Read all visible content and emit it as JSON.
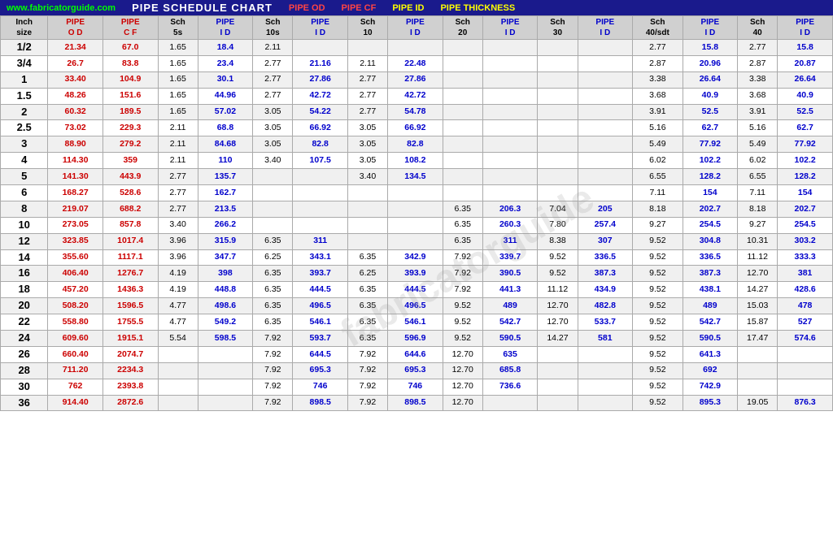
{
  "header": {
    "site": "www.fabricatorguide.com",
    "title": "PIPE SCHEDULE CHART",
    "od_label": "PIPE OD",
    "cf_label": "PIPE CF",
    "id_label": "PIPE ID",
    "thick_label": "PIPE THICKNESS"
  },
  "columns": [
    "Inch size",
    "PIPE OD",
    "PIPE CF",
    "Sch 5s",
    "PIPE ID",
    "Sch 10s",
    "PIPE ID",
    "Sch 10",
    "PIPE ID",
    "Sch 20",
    "PIPE ID",
    "Sch 30",
    "PIPE ID",
    "Sch 40/sdt",
    "PIPE ID",
    "Sch 40",
    "PIPE ID"
  ],
  "rows": [
    [
      "1/2",
      "21.34",
      "67.0",
      "1.65",
      "18.4",
      "2.11",
      "",
      "",
      "",
      "",
      "",
      "",
      "",
      "2.77",
      "15.8",
      "2.77",
      "15.8"
    ],
    [
      "3/4",
      "26.7",
      "83.8",
      "1.65",
      "23.4",
      "2.77",
      "21.16",
      "2.11",
      "22.48",
      "",
      "",
      "",
      "",
      "2.87",
      "20.96",
      "2.87",
      "20.87"
    ],
    [
      "1",
      "33.40",
      "104.9",
      "1.65",
      "30.1",
      "2.77",
      "27.86",
      "2.77",
      "27.86",
      "",
      "",
      "",
      "",
      "3.38",
      "26.64",
      "3.38",
      "26.64"
    ],
    [
      "1.5",
      "48.26",
      "151.6",
      "1.65",
      "44.96",
      "2.77",
      "42.72",
      "2.77",
      "42.72",
      "",
      "",
      "",
      "",
      "3.68",
      "40.9",
      "3.68",
      "40.9"
    ],
    [
      "2",
      "60.32",
      "189.5",
      "1.65",
      "57.02",
      "3.05",
      "54.22",
      "2.77",
      "54.78",
      "",
      "",
      "",
      "",
      "3.91",
      "52.5",
      "3.91",
      "52.5"
    ],
    [
      "2.5",
      "73.02",
      "229.3",
      "2.11",
      "68.8",
      "3.05",
      "66.92",
      "3.05",
      "66.92",
      "",
      "",
      "",
      "",
      "5.16",
      "62.7",
      "5.16",
      "62.7"
    ],
    [
      "3",
      "88.90",
      "279.2",
      "2.11",
      "84.68",
      "3.05",
      "82.8",
      "3.05",
      "82.8",
      "",
      "",
      "",
      "",
      "5.49",
      "77.92",
      "5.49",
      "77.92"
    ],
    [
      "4",
      "114.30",
      "359",
      "2.11",
      "110",
      "3.40",
      "107.5",
      "3.05",
      "108.2",
      "",
      "",
      "",
      "",
      "6.02",
      "102.2",
      "6.02",
      "102.2"
    ],
    [
      "5",
      "141.30",
      "443.9",
      "2.77",
      "135.7",
      "",
      "",
      "3.40",
      "134.5",
      "",
      "",
      "",
      "",
      "6.55",
      "128.2",
      "6.55",
      "128.2"
    ],
    [
      "6",
      "168.27",
      "528.6",
      "2.77",
      "162.7",
      "",
      "",
      "",
      "",
      "",
      "",
      "",
      "",
      "7.11",
      "154",
      "7.11",
      "154"
    ],
    [
      "8",
      "219.07",
      "688.2",
      "2.77",
      "213.5",
      "",
      "",
      "",
      "",
      "6.35",
      "206.3",
      "7.04",
      "205",
      "8.18",
      "202.7",
      "8.18",
      "202.7"
    ],
    [
      "10",
      "273.05",
      "857.8",
      "3.40",
      "266.2",
      "",
      "",
      "",
      "",
      "6.35",
      "260.3",
      "7.80",
      "257.4",
      "9.27",
      "254.5",
      "9.27",
      "254.5"
    ],
    [
      "12",
      "323.85",
      "1017.4",
      "3.96",
      "315.9",
      "6.35",
      "311",
      "",
      "",
      "6.35",
      "311",
      "8.38",
      "307",
      "9.52",
      "304.8",
      "10.31",
      "303.2"
    ],
    [
      "14",
      "355.60",
      "1117.1",
      "3.96",
      "347.7",
      "6.25",
      "343.1",
      "6.35",
      "342.9",
      "7.92",
      "339.7",
      "9.52",
      "336.5",
      "9.52",
      "336.5",
      "11.12",
      "333.3"
    ],
    [
      "16",
      "406.40",
      "1276.7",
      "4.19",
      "398",
      "6.35",
      "393.7",
      "6.25",
      "393.9",
      "7.92",
      "390.5",
      "9.52",
      "387.3",
      "9.52",
      "387.3",
      "12.70",
      "381"
    ],
    [
      "18",
      "457.20",
      "1436.3",
      "4.19",
      "448.8",
      "6.35",
      "444.5",
      "6.35",
      "444.5",
      "7.92",
      "441.3",
      "11.12",
      "434.9",
      "9.52",
      "438.1",
      "14.27",
      "428.6"
    ],
    [
      "20",
      "508.20",
      "1596.5",
      "4.77",
      "498.6",
      "6.35",
      "496.5",
      "6.35",
      "496.5",
      "9.52",
      "489",
      "12.70",
      "482.8",
      "9.52",
      "489",
      "15.03",
      "478"
    ],
    [
      "22",
      "558.80",
      "1755.5",
      "4.77",
      "549.2",
      "6.35",
      "546.1",
      "6.35",
      "546.1",
      "9.52",
      "542.7",
      "12.70",
      "533.7",
      "9.52",
      "542.7",
      "15.87",
      "527"
    ],
    [
      "24",
      "609.60",
      "1915.1",
      "5.54",
      "598.5",
      "7.92",
      "593.7",
      "6.35",
      "596.9",
      "9.52",
      "590.5",
      "14.27",
      "581",
      "9.52",
      "590.5",
      "17.47",
      "574.6"
    ],
    [
      "26",
      "660.40",
      "2074.7",
      "",
      "",
      "7.92",
      "644.5",
      "7.92",
      "644.6",
      "12.70",
      "635",
      "",
      "",
      "9.52",
      "641.3",
      "",
      ""
    ],
    [
      "28",
      "711.20",
      "2234.3",
      "",
      "",
      "7.92",
      "695.3",
      "7.92",
      "695.3",
      "12.70",
      "685.8",
      "",
      "",
      "9.52",
      "692",
      "",
      ""
    ],
    [
      "30",
      "762",
      "2393.8",
      "",
      "",
      "7.92",
      "746",
      "7.92",
      "746",
      "12.70",
      "736.6",
      "",
      "",
      "9.52",
      "742.9",
      "",
      ""
    ],
    [
      "36",
      "914.40",
      "2872.6",
      "",
      "",
      "7.92",
      "898.5",
      "7.92",
      "898.5",
      "12.70",
      "",
      "",
      "",
      "9.52",
      "895.3",
      "19.05",
      "876.3"
    ]
  ]
}
